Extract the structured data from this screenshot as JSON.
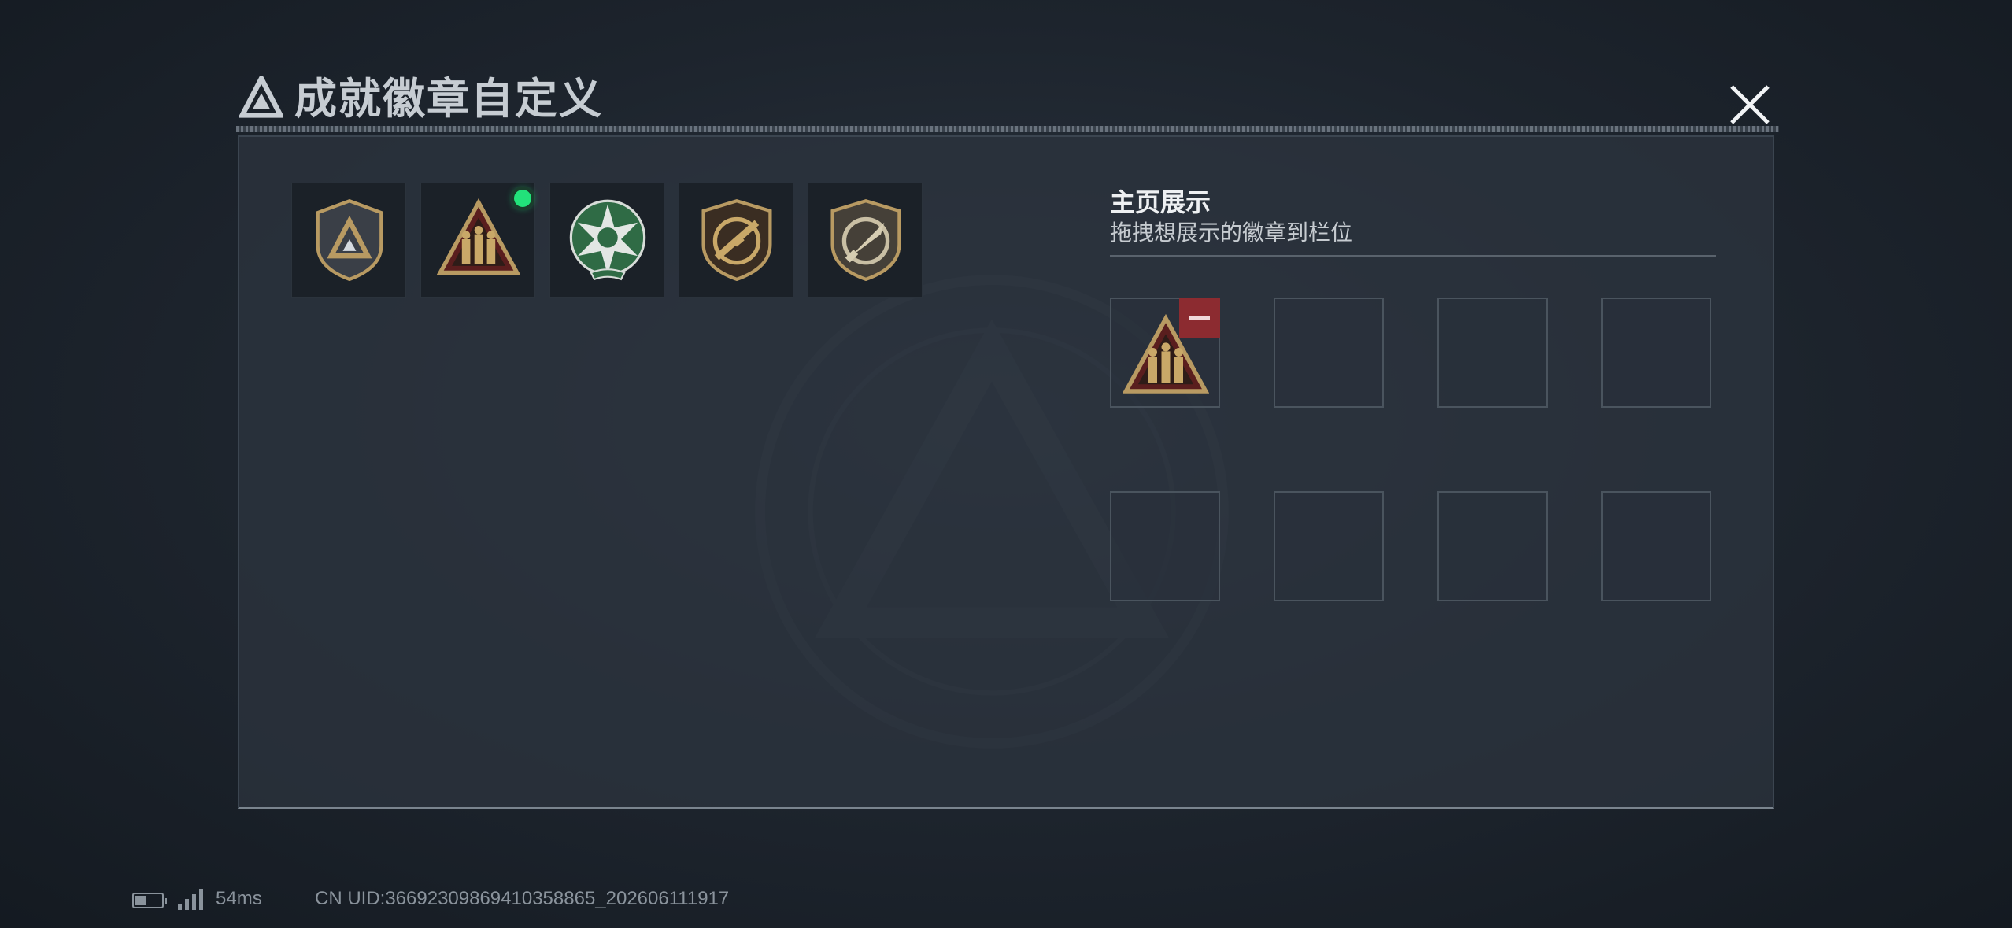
{
  "window": {
    "title": "成就徽章自定义"
  },
  "badge_list": [
    {
      "icon": "shield-triangle-badge",
      "is_new": false
    },
    {
      "icon": "squad-triangle-badge",
      "is_new": true
    },
    {
      "icon": "green-star-skull-badge",
      "is_new": false
    },
    {
      "icon": "sniper-shield-badge",
      "is_new": false
    },
    {
      "icon": "knife-shield-badge",
      "is_new": false
    }
  ],
  "showcase": {
    "title": "主页展示",
    "subtitle": "拖拽想展示的徽章到栏位",
    "slots": [
      {
        "filled": true,
        "icon": "squad-triangle-badge"
      },
      {
        "filled": false
      },
      {
        "filled": false
      },
      {
        "filled": false
      },
      {
        "filled": false
      },
      {
        "filled": false
      },
      {
        "filled": false
      },
      {
        "filled": false
      }
    ]
  },
  "status_bar": {
    "ping": "54ms",
    "uid": "CN UID:3669230986941035886​5_202606111917"
  },
  "colors": {
    "accent_new": "#22e27a",
    "remove": "#8c2b30",
    "gold": "#b89a62"
  }
}
